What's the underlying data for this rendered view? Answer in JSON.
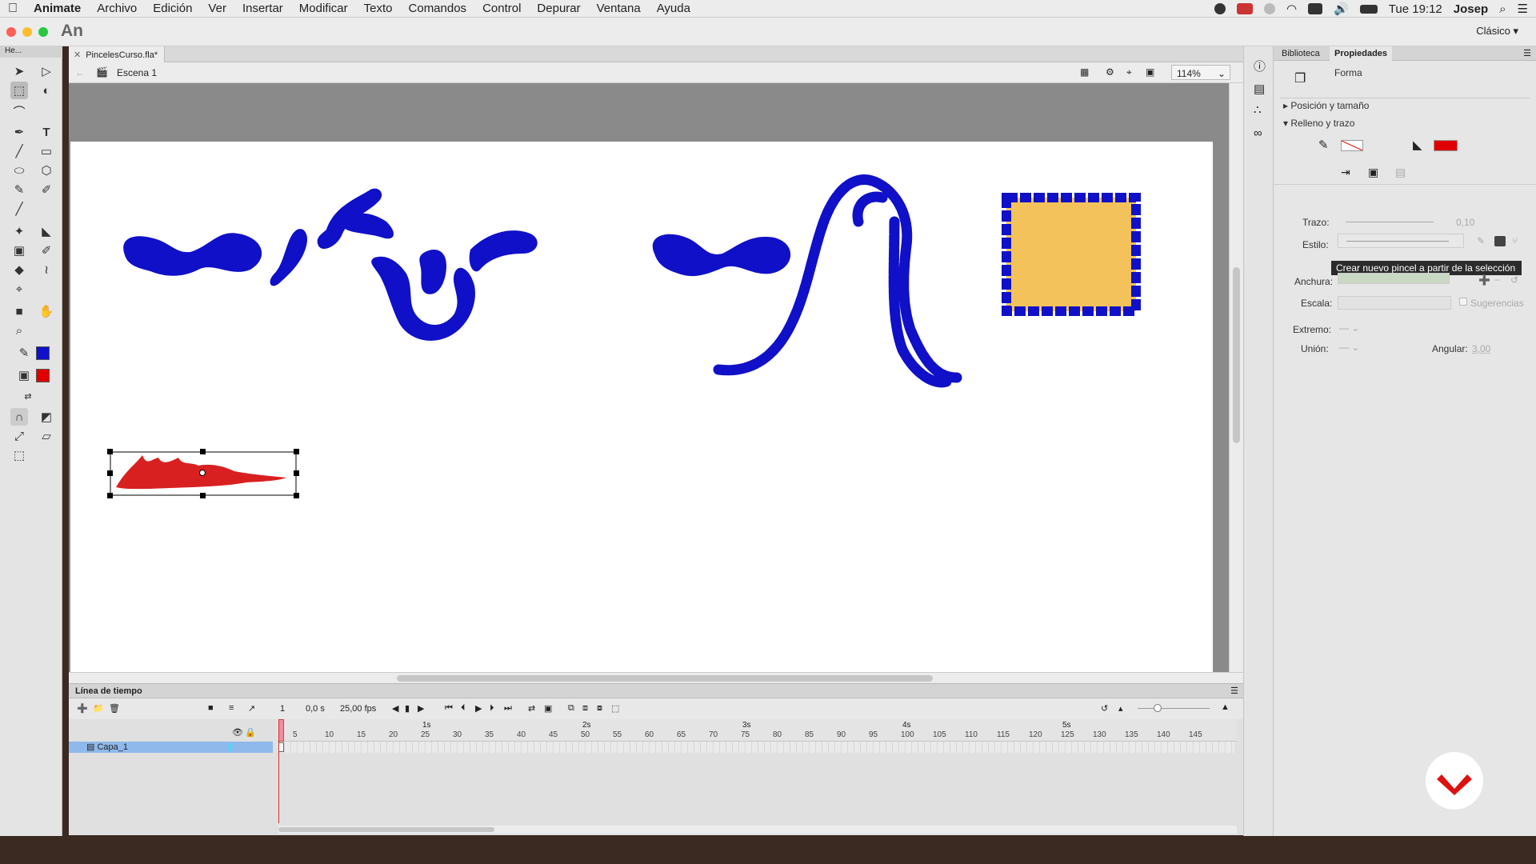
{
  "menubar": {
    "app": "Animate",
    "items": [
      "Archivo",
      "Edición",
      "Ver",
      "Insertar",
      "Modificar",
      "Texto",
      "Comandos",
      "Control",
      "Depurar",
      "Ventana",
      "Ayuda"
    ],
    "clock": "Tue 19:12",
    "user": "Josep"
  },
  "titlebar": {
    "logo": "An",
    "workspace": "Clásico"
  },
  "tools": {
    "header": "He..."
  },
  "document": {
    "tab": "PincelesCurso.fla*",
    "scene": "Escena 1",
    "zoom": "114%"
  },
  "timeline": {
    "title": "Línea de tiempo",
    "frame": "1",
    "time": "0,0 s",
    "fps": "25,00 fps",
    "layer": "Capa_1",
    "seconds": [
      "1s",
      "2s",
      "3s",
      "4s",
      "5s"
    ],
    "frames": [
      "5",
      "10",
      "15",
      "20",
      "25",
      "30",
      "35",
      "40",
      "45",
      "50",
      "55",
      "60",
      "65",
      "70",
      "75",
      "80",
      "85",
      "90",
      "95",
      "100",
      "105",
      "110",
      "115",
      "120",
      "125",
      "130",
      "135",
      "140",
      "145"
    ]
  },
  "panel": {
    "tabs": [
      "Biblioteca",
      "Propiedades"
    ],
    "active": "Propiedades",
    "type": "Forma",
    "section_pos": "Posición y tamaño",
    "section_fill": "Relleno y trazo",
    "trazo_label": "Trazo:",
    "trazo_value": "0,10",
    "estilo_label": "Estilo:",
    "tooltip": "Crear nuevo pincel a partir de la selección",
    "anchura_label": "Anchura:",
    "escala_label": "Escala:",
    "sugerencias": "Sugerencias",
    "extremo_label": "Extremo:",
    "union_label": "Unión:",
    "angular_label": "Angular:",
    "angular_value": "3,00",
    "stroke_color": "#1010c8",
    "fill_color": "#e00000"
  }
}
